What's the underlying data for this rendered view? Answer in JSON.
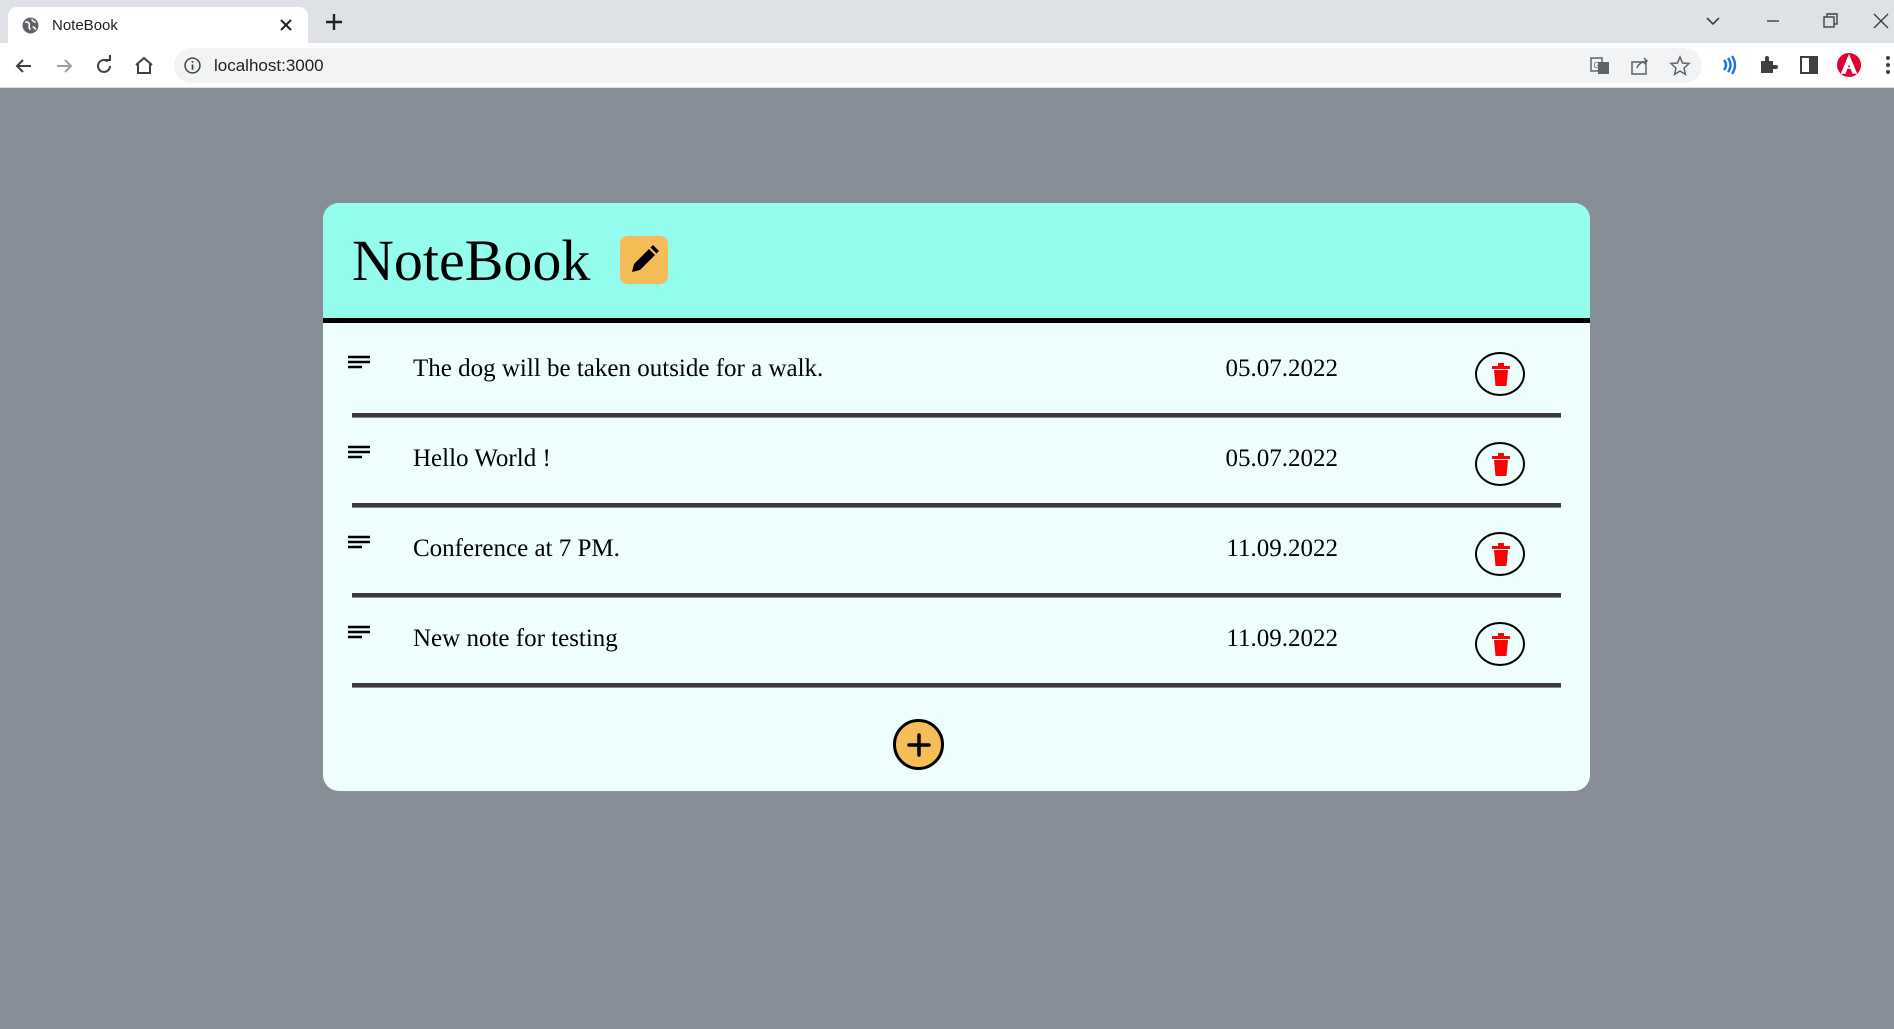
{
  "browser": {
    "tab_title": "NoteBook",
    "url": "localhost:3000"
  },
  "app": {
    "title": "NoteBook",
    "accent_color": "#f5bd57",
    "header_color": "#94fded",
    "delete_color": "#ff0000"
  },
  "notes": [
    {
      "text": "The dog will be taken outside for a walk.",
      "date": "05.07.2022"
    },
    {
      "text": "Hello World !",
      "date": "05.07.2022"
    },
    {
      "text": "Conference at 7 PM.",
      "date": "11.09.2022"
    },
    {
      "text": "New note for testing",
      "date": "11.09.2022"
    }
  ],
  "icons": {
    "edit": "pencil-icon",
    "note": "lines-icon",
    "delete": "trash-icon",
    "add": "plus-icon"
  }
}
